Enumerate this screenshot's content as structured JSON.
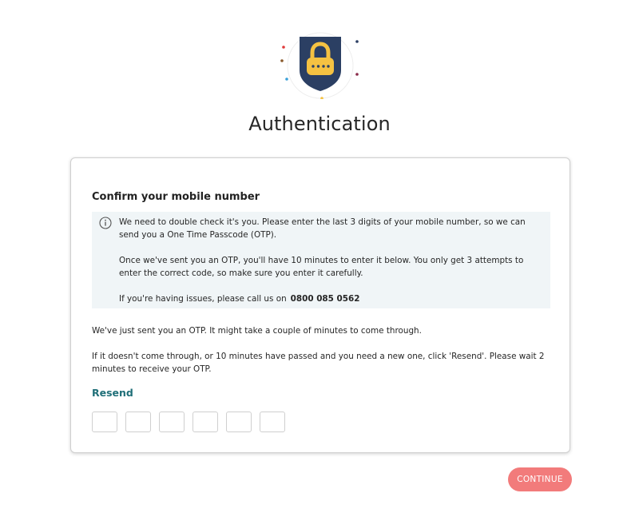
{
  "header": {
    "title": "Authentication",
    "illustration_icon": "shield-lock-icon"
  },
  "card": {
    "heading": "Confirm your mobile number",
    "info": {
      "icon": "info-icon",
      "paragraph_1": "We need to double check it's you. Please enter the last 3 digits of your mobile number, so we can send you a One Time Passcode (OTP).",
      "paragraph_2": "Once we've sent you an OTP, you'll have 10 minutes to enter it below. You only get 3 attempts to enter the correct code, so make sure you enter it carefully.",
      "paragraph_3": "If you're having issues, please call us on",
      "phone_number": "0800 085 0562"
    },
    "sent_message": "We've just sent you an OTP. It might take a couple of minutes to come through.",
    "resend_message": "If it doesn't come through, or 10 minutes have passed and you need a new one, click 'Resend'. Please wait 2 minutes to receive your OTP.",
    "resend_label": "Resend",
    "otp_digits": [
      "",
      "",
      "",
      "",
      "",
      ""
    ]
  },
  "footer": {
    "continue_label": "CONTINUE"
  },
  "colors": {
    "shield": "#2b3f63",
    "lock": "#f5c242",
    "link": "#1f6f78",
    "continue_button": "#f27b7b",
    "info_background": "#f0f5f7"
  }
}
